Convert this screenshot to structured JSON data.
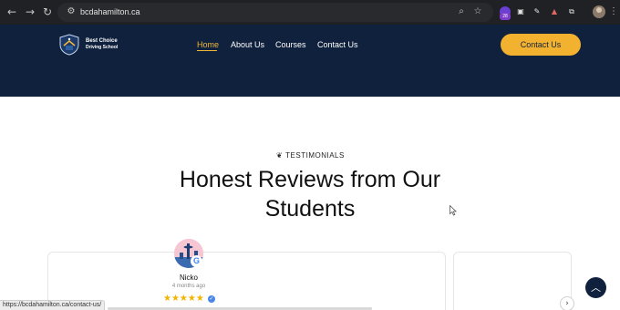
{
  "browser": {
    "back_icon": "arrow-left-icon",
    "forward_icon": "arrow-right-icon",
    "reload_icon": "reload-icon",
    "url": "bcdahamilton.ca",
    "extension_badge_count": "28",
    "status_url": "https://bcdahamilton.ca/contact-us/"
  },
  "header": {
    "logo_line1": "Best Choice",
    "logo_line2": "Driving School",
    "nav": [
      {
        "label": "Home"
      },
      {
        "label": "About Us"
      },
      {
        "label": "Courses"
      },
      {
        "label": "Contact Us"
      }
    ],
    "cta_label": "Contact Us",
    "colors": {
      "background": "#10213d",
      "accent": "#f0b63c"
    }
  },
  "testimonials": {
    "eyebrow": "TESTIMONIALS",
    "heading_line1": "Honest Reviews from Our",
    "heading_line2": "Students",
    "review": {
      "reviewer": "Nicko",
      "time": "4 months ago",
      "rating": 5,
      "stars": "★★★★★"
    }
  }
}
